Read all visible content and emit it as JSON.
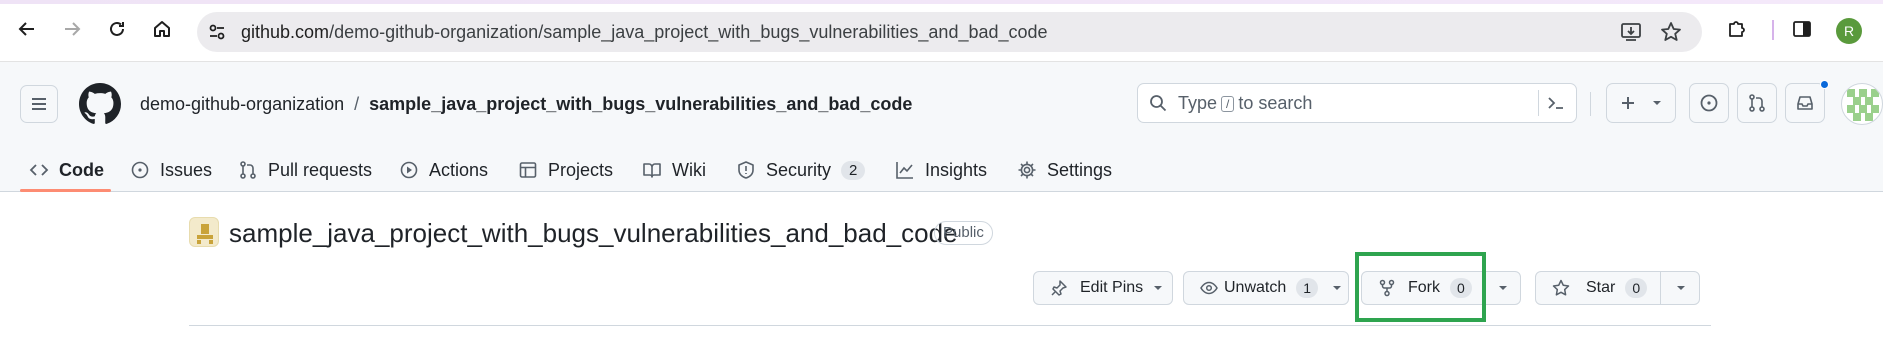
{
  "browser": {
    "url_host": "github.com",
    "url_path": "/demo-github-organization/sample_java_project_with_bugs_vulnerabilities_and_bad_code",
    "profile_initial": "R"
  },
  "header": {
    "org": "demo-github-organization",
    "separator": "/",
    "repo": "sample_java_project_with_bugs_vulnerabilities_and_bad_code",
    "search_prefix": "Type",
    "search_key": "/",
    "search_suffix": "to search"
  },
  "tabs": [
    {
      "label": "Code",
      "icon": "code-icon",
      "selected": true
    },
    {
      "label": "Issues",
      "icon": "issue-icon"
    },
    {
      "label": "Pull requests",
      "icon": "pull-request-icon"
    },
    {
      "label": "Actions",
      "icon": "play-icon"
    },
    {
      "label": "Projects",
      "icon": "table-icon"
    },
    {
      "label": "Wiki",
      "icon": "book-icon"
    },
    {
      "label": "Security",
      "icon": "shield-icon",
      "counter": "2"
    },
    {
      "label": "Insights",
      "icon": "graph-icon"
    },
    {
      "label": "Settings",
      "icon": "gear-icon"
    }
  ],
  "repo_header": {
    "name": "sample_java_project_with_bugs_vulnerabilities_and_bad_code",
    "visibility": "Public"
  },
  "actions": {
    "edit_pins": "Edit Pins",
    "unwatch": "Unwatch",
    "watch_count": "1",
    "fork": "Fork",
    "fork_count": "0",
    "star": "Star",
    "star_count": "0"
  },
  "colors": {
    "highlight": "#2ea44f",
    "tab_underline": "#fd8c73",
    "notification_dot": "#0969da"
  }
}
